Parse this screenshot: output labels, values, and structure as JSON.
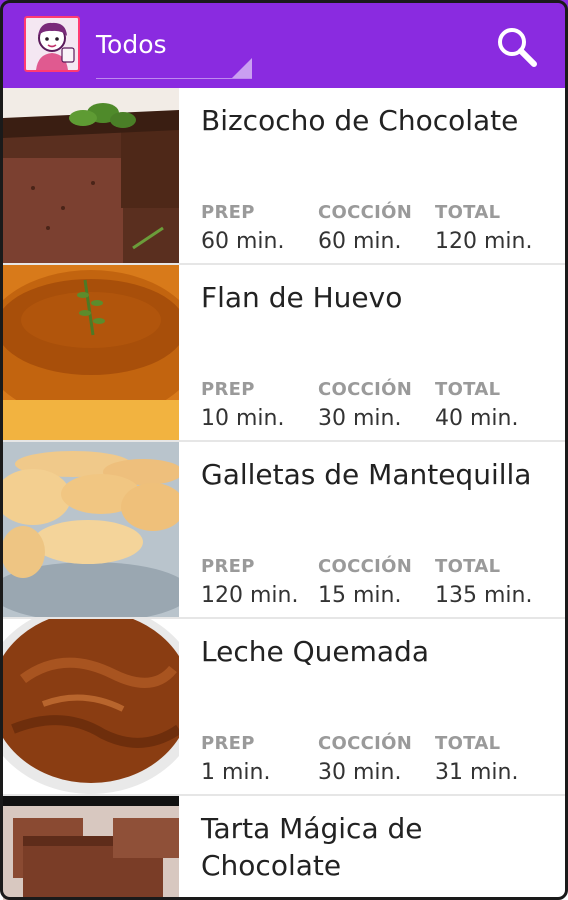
{
  "colors": {
    "actionbar": "#8a2be0",
    "title_text": "#222222",
    "label_text": "#9a9a9a",
    "value_text": "#333333"
  },
  "header": {
    "app_icon": "chef-girl-logo",
    "category": "Todos",
    "search_icon": "search-icon"
  },
  "stat_labels": {
    "prep": "PREP",
    "cook": "COCCIÓN",
    "total": "TOTAL"
  },
  "recipes": [
    {
      "title": "Bizcocho de Chocolate",
      "prep": "60 min.",
      "cook": "60 min.",
      "total": "120 min.",
      "image": "chocolate-cake"
    },
    {
      "title": "Flan de Huevo",
      "prep": "10 min.",
      "cook": "30 min.",
      "total": "40 min.",
      "image": "caramel-flan"
    },
    {
      "title": "Galletas de Mantequilla",
      "prep": "120 min.",
      "cook": "15 min.",
      "total": "135 min.",
      "image": "butter-cookies"
    },
    {
      "title": "Leche Quemada",
      "prep": "1 min.",
      "cook": "30 min.",
      "total": "31 min.",
      "image": "caramel-cream"
    },
    {
      "title": "Tarta Mágica de Chocolate",
      "image": "chocolate-brownie"
    }
  ]
}
